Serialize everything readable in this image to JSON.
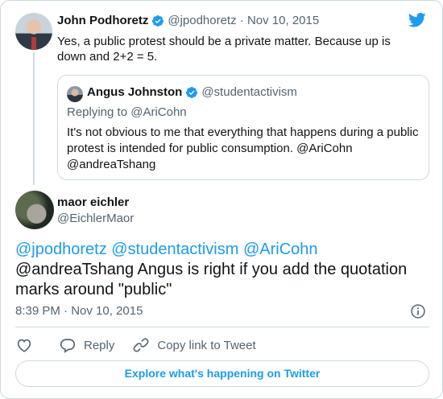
{
  "parent": {
    "name": "John Podhoretz",
    "handle": "@jpodhoretz",
    "separator": "·",
    "date": "Nov 10, 2015",
    "text": "Yes, a public protest should be a private matter. Because up is down and 2+2 = 5."
  },
  "quote": {
    "name": "Angus Johnston",
    "handle": "@studentactivism",
    "replying_prefix": "Replying to ",
    "replying_to": "@AriCohn",
    "text": "It's not obvious to me that everything that happens during a public protest is intended for public consumption. @AriCohn @andreaTshang"
  },
  "main": {
    "name": "maor eichler",
    "handle": "@EichlerMaor",
    "mentions": "@jpodhoretz @studentactivism @AriCohn",
    "text": "@andreaTshang Angus is right if you add the quotation marks around \"public\"",
    "time": "8:39 PM · Nov 10, 2015"
  },
  "actions": {
    "reply_label": "Reply",
    "copy_label": "Copy link to Tweet"
  },
  "explore_label": "Explore what's happening on Twitter",
  "colors": {
    "accent": "#1d9bf0",
    "muted": "#536471",
    "border": "#cfd9de"
  },
  "icons": [
    "verified-badge-icon",
    "twitter-bird-icon",
    "info-icon",
    "heart-icon",
    "reply-icon",
    "link-icon"
  ]
}
